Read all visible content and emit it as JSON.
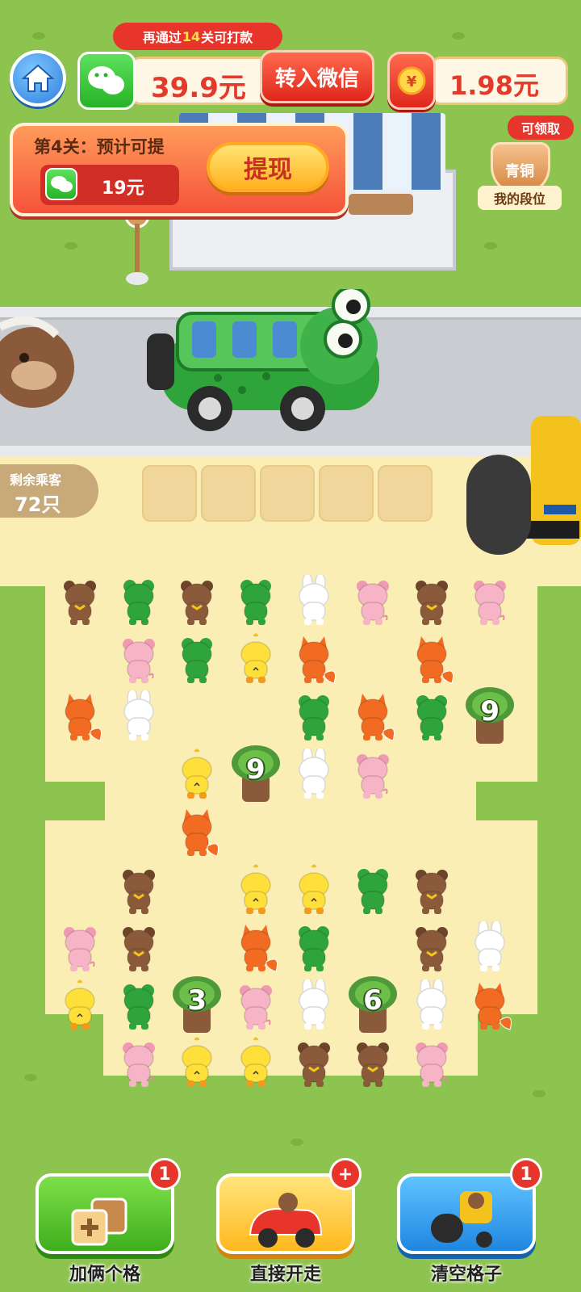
{
  "top_bar": {
    "tooltip_prefix": "再通过",
    "tooltip_levels": "14",
    "tooltip_suffix": "关可打款",
    "wechat_balance": "39.9元",
    "transfer_label": "转入微信",
    "red_packet_balance": "1.98元"
  },
  "level_panel": {
    "title": "第4关：预计可提",
    "amount": "19元",
    "withdraw_label": "提现"
  },
  "rank": {
    "claim_tag": "可领取",
    "tier": "青铜",
    "label": "我的段位"
  },
  "queue": {
    "remaining_label": "剩余乘客",
    "remaining_value": "72只",
    "empty_slots": 5
  },
  "board": {
    "rows": [
      [
        "bear",
        "frog",
        "bear",
        "frog",
        "rabbit",
        "pig",
        "bear",
        "pig"
      ],
      [
        "",
        "pig",
        "frog",
        "chick",
        "fox",
        "",
        "fox",
        ""
      ],
      [
        "fox",
        "rabbit",
        "",
        "",
        "frog",
        "fox",
        "frog",
        "tree:9"
      ],
      [
        "",
        "",
        "chick",
        "tree:9",
        "rabbit",
        "pig",
        "",
        ""
      ],
      [
        "",
        "",
        "fox",
        "",
        "",
        "",
        "",
        ""
      ],
      [
        "",
        "bear",
        "",
        "chick",
        "chick",
        "frog",
        "bear",
        ""
      ],
      [
        "pig",
        "bear",
        "",
        "fox",
        "frog",
        "",
        "bear",
        "rabbit"
      ],
      [
        "chick",
        "frog",
        "tree:3",
        "pig",
        "rabbit",
        "tree:6",
        "rabbit",
        "fox"
      ],
      [
        "",
        "pig",
        "chick",
        "chick",
        "bear",
        "bear",
        "pig",
        ""
      ]
    ]
  },
  "tools": [
    {
      "label": "加俩个格",
      "badge": "1"
    },
    {
      "label": "直接开走",
      "badge": "+"
    },
    {
      "label": "清空格子",
      "badge": "1"
    }
  ],
  "colors": {
    "grass": "#8dc34f",
    "sand": "#fbeeb5",
    "accent_red": "#e8352b",
    "wechat_green": "#26b326"
  }
}
